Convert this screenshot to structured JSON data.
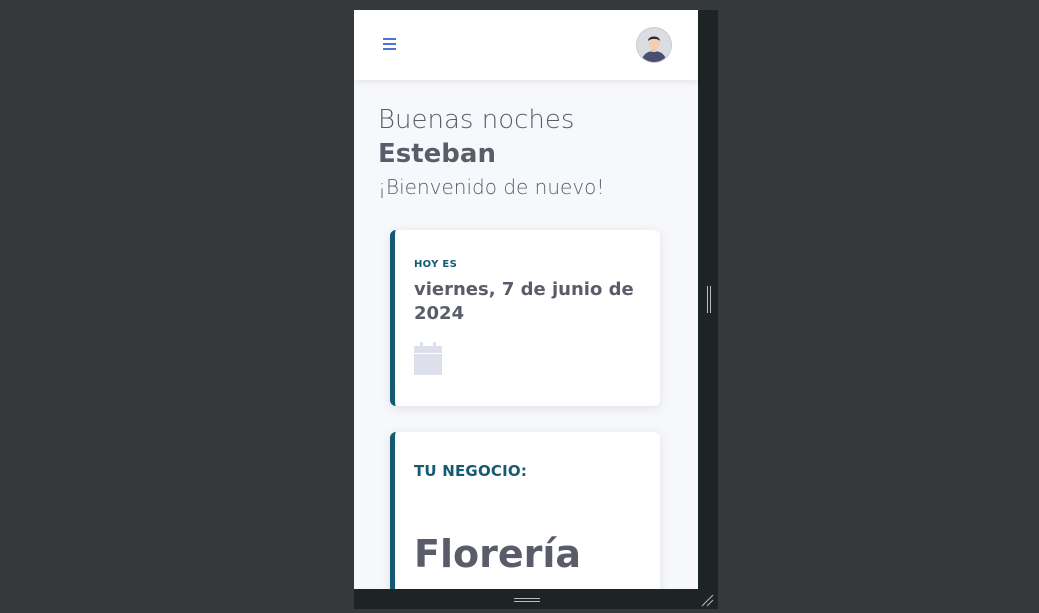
{
  "header": {
    "menu_icon": "hamburger-menu-icon",
    "avatar": "user-avatar",
    "accent_color": "#4e73df"
  },
  "greeting": {
    "line": "Buenas noches",
    "name": "Esteban",
    "welcome": "¡Bienvenido de nuevo!"
  },
  "date_card": {
    "label": "HOY ES",
    "value": "viernes, 7 de junio de 2024",
    "icon": "calendar-icon"
  },
  "business_card": {
    "label": "TU NEGOCIO:",
    "value": "Florería"
  },
  "colors": {
    "page_background": "#35393c",
    "device_frame": "#1d2426",
    "content_background": "#f7f8fc",
    "card_accent": "#145a72",
    "text": "#5a5c69"
  }
}
